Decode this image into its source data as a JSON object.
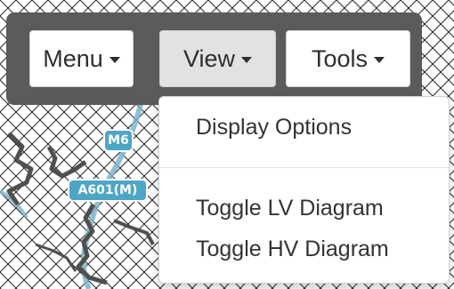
{
  "toolbar": {
    "buttons": [
      {
        "label": "Menu"
      },
      {
        "label": "View"
      },
      {
        "label": "Tools"
      }
    ]
  },
  "view_dropdown": {
    "items": [
      {
        "label": "Display Options"
      },
      {
        "label": "Toggle LV Diagram"
      },
      {
        "label": "Toggle HV Diagram"
      }
    ]
  },
  "map": {
    "road_labels": [
      "M6",
      "A601(M)"
    ],
    "colors": {
      "road_label_bg": "#4ea6c6",
      "water": "#7fb4cc",
      "network_line": "#4f504d",
      "hatch_grid": "#2c2c2c"
    }
  }
}
